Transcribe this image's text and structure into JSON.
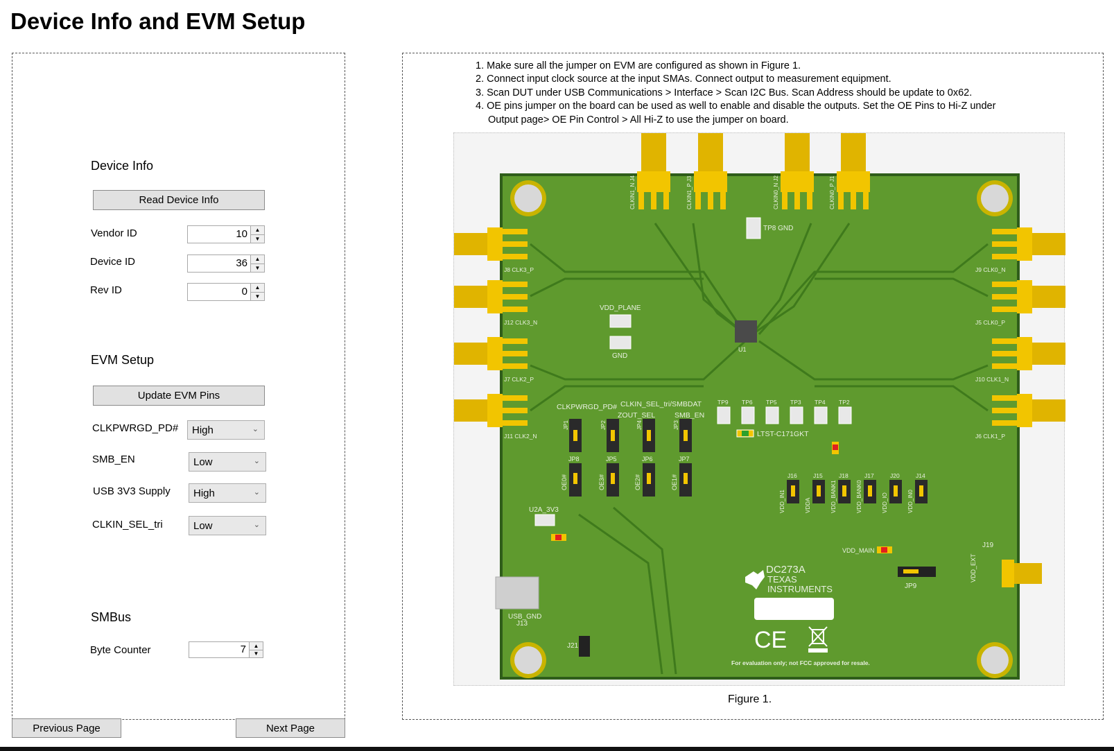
{
  "page": {
    "title": "Device Info and EVM Setup"
  },
  "device_info": {
    "section_title": "Device Info",
    "read_button": "Read Device Info",
    "fields": [
      {
        "label": "Vendor ID",
        "value": "10"
      },
      {
        "label": "Device ID",
        "value": "36"
      },
      {
        "label": "Rev ID",
        "value": "0"
      }
    ]
  },
  "evm_setup": {
    "section_title": "EVM Setup",
    "update_button": "Update EVM Pins",
    "selects": [
      {
        "label": "CLKPWRGD_PD#",
        "value": "High"
      },
      {
        "label": "SMB_EN",
        "value": "Low"
      },
      {
        "label": "USB 3V3 Supply",
        "value": "High"
      },
      {
        "label": "CLKIN_SEL_tri",
        "value": "Low"
      }
    ]
  },
  "smbus": {
    "section_title": "SMBus",
    "byte_counter_label": "Byte Counter",
    "byte_counter_value": "7"
  },
  "nav": {
    "previous": "Previous Page",
    "next": "Next Page"
  },
  "instructions": [
    "1. Make sure all the jumper on EVM are configured as shown in Figure 1.",
    "2. Connect input clock source at the input SMAs. Connect output to measurement equipment.",
    "3. Scan DUT under USB Communications > Interface > Scan I2C Bus. Scan Address should be update to 0x62.",
    "4. OE pins jumper on the board can be used as well to enable and disable the outputs. Set the OE Pins to Hi-Z under Output page> OE Pin Control > All Hi-Z to use the jumper on board."
  ],
  "figure": {
    "caption": "Figure 1.",
    "board": {
      "name": "DC273A",
      "brand_line1": "TEXAS",
      "brand_line2": "INSTRUMENTS",
      "disclaimer": "For evaluation only; not FCC approved for resale.",
      "ce_mark": "CE",
      "top_connectors": [
        "CLKIN1_N J4",
        "CLKIN1_P J3",
        "CLKIN0_N J2",
        "CLKIN0_P J1"
      ],
      "left_connectors": [
        "J8 CLK3_P",
        "J12 CLK3_N",
        "J7 CLK2_P",
        "J11 CLK2_N"
      ],
      "right_connectors": [
        "J9 CLK0_N",
        "J5 CLK0_P",
        "J10 CLK1_N",
        "J6 CLK1_P"
      ],
      "jumper_labels": [
        "CLKPWRGD_PD#",
        "ZOUT_SEL",
        "CLKIN_SEL_tri/SMBDAT",
        "SMB_EN"
      ],
      "oe_labels": [
        "OE0#",
        "OE3#",
        "OE2#",
        "OE1#"
      ],
      "jumpers_top": [
        "JP1",
        "JP2",
        "JP4",
        "JP3"
      ],
      "jumpers_bottom": [
        "JP8",
        "JP5",
        "JP6",
        "JP7"
      ],
      "testpoints": [
        "TP9",
        "TP6",
        "TP5",
        "TP3",
        "TP4",
        "TP2"
      ],
      "supply_jumpers": [
        "J16",
        "J15",
        "J18",
        "J17",
        "J20",
        "J14"
      ],
      "supply_labels": [
        "VDD_IN1",
        "VDDA",
        "VDD_BANK1",
        "VDD_BANK0",
        "VDD_IO",
        "VDD_IN0"
      ],
      "led_part": "LTST-C171GKT",
      "vdd_plane": "VDD_PLANE",
      "gnd": "GND",
      "tp8": "TP8 GND",
      "u2a": "U2A_3V3",
      "usb_gnd": "USB_GND",
      "j13": "J13",
      "vdd_main": "VDD_MAIN",
      "vdd_ext": "VDD_EXT",
      "j19": "J19",
      "jp9": "JP9",
      "j21": "J21",
      "u1": "U1"
    }
  },
  "colors": {
    "board_green": "#5f9a2e",
    "board_edge": "#2f5d1a",
    "gold": "#f2c500",
    "silk": "#e8f0e0"
  }
}
